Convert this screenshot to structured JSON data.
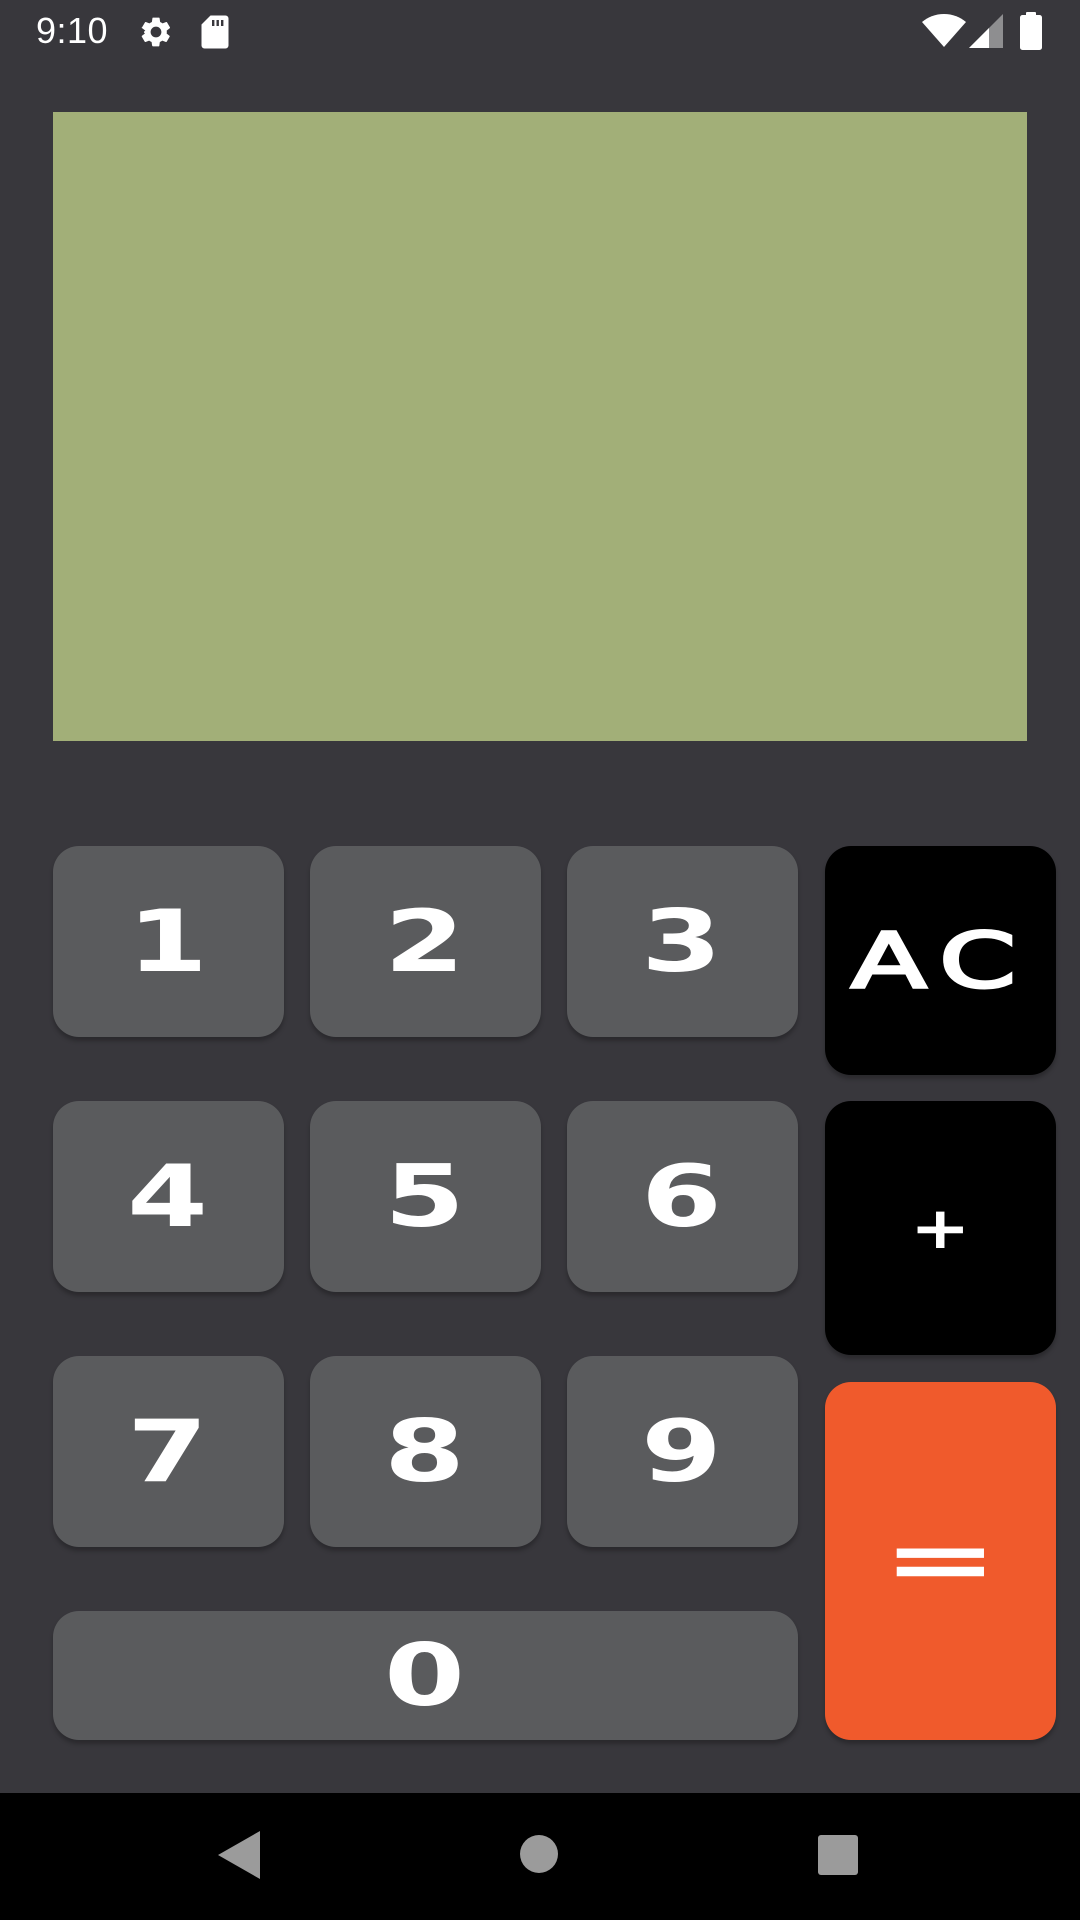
{
  "status_bar": {
    "time": "9:10",
    "icons": [
      "gear-icon",
      "sd-card-icon",
      "wifi-icon",
      "signal-icon",
      "battery-icon"
    ]
  },
  "display": {
    "value": "",
    "background_color": "#a2af78"
  },
  "keypad": {
    "digits": {
      "one": "1",
      "two": "2",
      "three": "3",
      "four": "4",
      "five": "5",
      "six": "6",
      "seven": "7",
      "eight": "8",
      "nine": "9",
      "zero": "0"
    },
    "clear_label": "AC",
    "plus_label": "+",
    "equals_label": "="
  },
  "colors": {
    "background": "#38373c",
    "digit_key": "#5a5b5d",
    "operator_key": "#000000",
    "equals_key": "#f05a2c"
  },
  "nav_bar": {
    "icons": [
      "back-icon",
      "home-icon",
      "recents-icon"
    ]
  }
}
